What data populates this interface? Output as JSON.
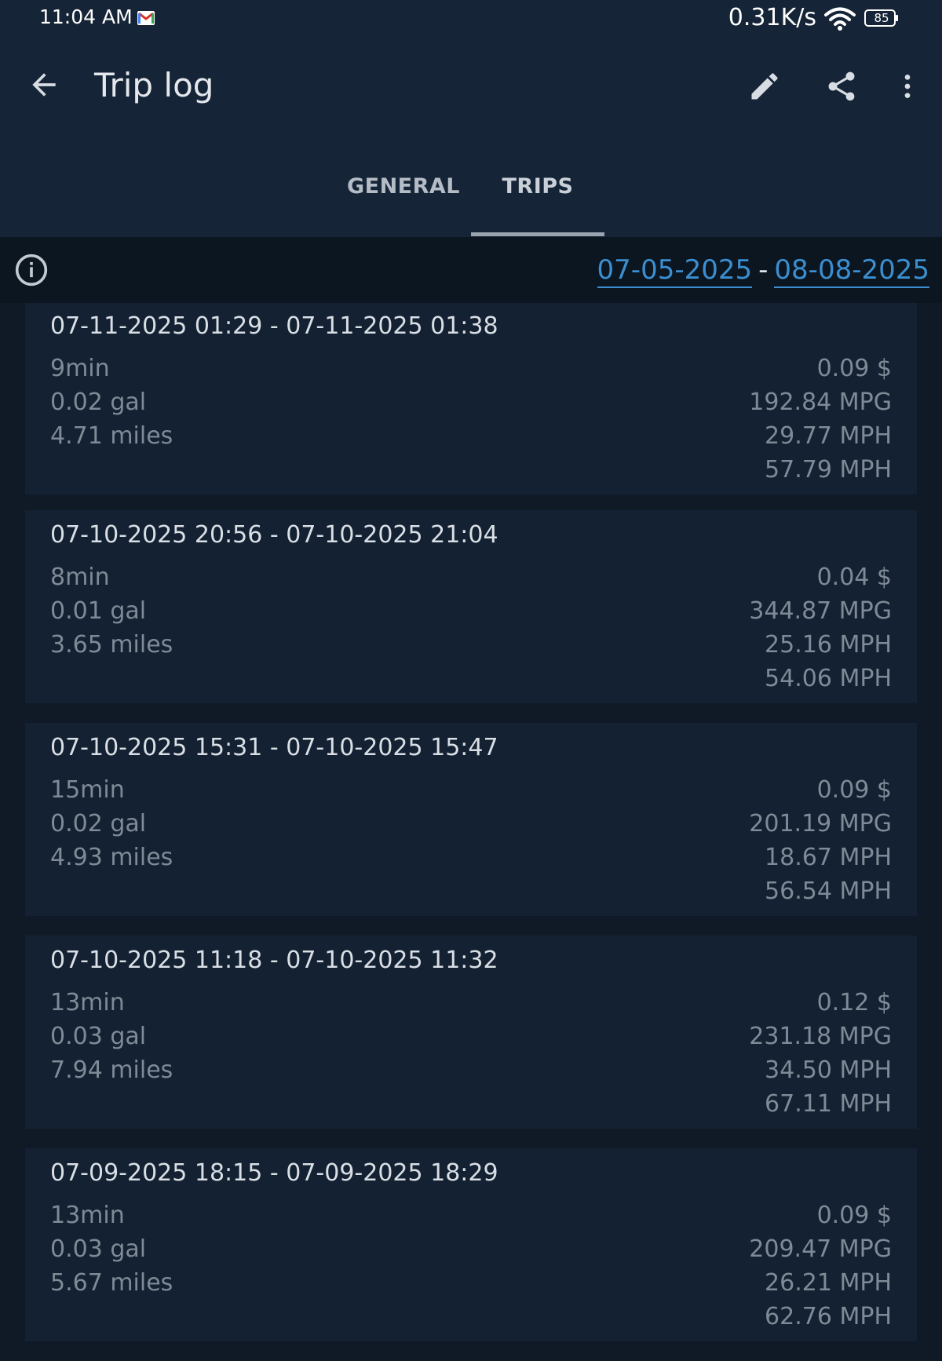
{
  "status_bar": {
    "time": "11:04 AM",
    "net_speed": "0.31K/s",
    "battery": "85"
  },
  "app_bar": {
    "title": "Trip log"
  },
  "tabs": [
    {
      "label": "GENERAL"
    },
    {
      "label": "TRIPS"
    }
  ],
  "filter": {
    "start_date": "07-05-2025",
    "separator": "-",
    "end_date": "08-08-2025"
  },
  "trips": [
    {
      "range": "07-11-2025 01:29 - 07-11-2025 01:38",
      "duration": "9min",
      "fuel": "0.02 gal",
      "distance": "4.71 miles",
      "cost": "0.09 $",
      "economy": "192.84 MPG",
      "avg_speed": "29.77 MPH",
      "max_speed": "57.79 MPH"
    },
    {
      "range": "07-10-2025 20:56 - 07-10-2025 21:04",
      "duration": "8min",
      "fuel": "0.01 gal",
      "distance": "3.65 miles",
      "cost": "0.04 $",
      "economy": "344.87 MPG",
      "avg_speed": "25.16 MPH",
      "max_speed": "54.06 MPH"
    },
    {
      "range": "07-10-2025 15:31 - 07-10-2025 15:47",
      "duration": "15min",
      "fuel": "0.02 gal",
      "distance": "4.93 miles",
      "cost": "0.09 $",
      "economy": "201.19 MPG",
      "avg_speed": "18.67 MPH",
      "max_speed": "56.54 MPH"
    },
    {
      "range": "07-10-2025 11:18 - 07-10-2025 11:32",
      "duration": "13min",
      "fuel": "0.03 gal",
      "distance": "7.94 miles",
      "cost": "0.12 $",
      "economy": "231.18 MPG",
      "avg_speed": "34.50 MPH",
      "max_speed": "67.11 MPH"
    },
    {
      "range": "07-09-2025 18:15 - 07-09-2025 18:29",
      "duration": "13min",
      "fuel": "0.03 gal",
      "distance": "5.67 miles",
      "cost": "0.09 $",
      "economy": "209.47 MPG",
      "avg_speed": "26.21 MPH",
      "max_speed": "62.76 MPH"
    }
  ]
}
